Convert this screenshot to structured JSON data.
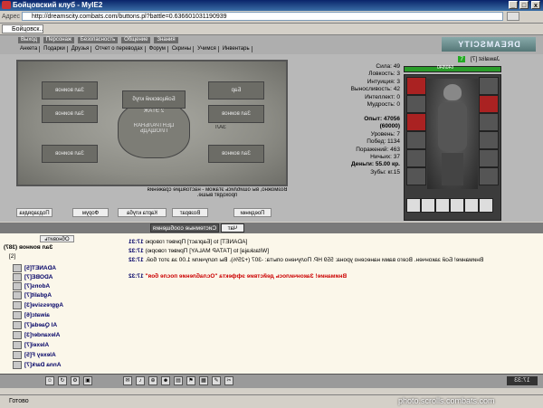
{
  "window": {
    "title": "Бойцовский клуб - MyIE2",
    "buttons": [
      "_",
      "□",
      "x"
    ]
  },
  "address": {
    "label": "Адрес",
    "url": "http://dreamscity.combats.com/buttons.pl?battle=0.636601031190939"
  },
  "tabs": [
    {
      "label": "Бойцовск..."
    }
  ],
  "game_nav": {
    "row1": [
      "Выход",
      "Персонаж",
      "Безопасность",
      "Общение",
      "Знания"
    ],
    "row2": [
      "Анкета",
      "Подарки",
      "Друзья",
      "Отчет о переводах",
      "Форум",
      "Скрины",
      "Учимся",
      "Инвентарь"
    ],
    "logo": "DREAMSCITY"
  },
  "map": {
    "rooms": [
      "Зал воинов",
      "Зал воинов",
      "Бойцовский клуб",
      "Зал воинов",
      "Зал воинов",
      "Бар",
      "Зал воинов"
    ],
    "center": [
      "2 ЭТАЖ",
      "ЦЕНТРАЛЬНАЯ",
      "ПЛОЩАДЬ",
      "ЗАЛ"
    ],
    "note": "Возможно, вы ошиблись этажом - настоящие сражения проходят выше."
  },
  "stats_top": [
    "Сила: 49",
    "Ловкость: 3",
    "Интуиция: 3",
    "Выносливость: 42",
    "Интеллект: 0",
    "Мудрость: 0"
  ],
  "stats_bottom": [
    "Опыт: 47056 (60000)",
    "Уровень: 7",
    "Побед: 1134",
    "Поражений: 463",
    "Ничьих: 37",
    "Деньги: 55.00 кр.",
    "Зубы: кг.15"
  ],
  "character": {
    "nick": "Jawalist [7]",
    "level_badge": "7",
    "hp": "640/640"
  },
  "actions": [
    "Подзарядка",
    "Форум",
    "Карта клуба",
    "Возврат",
    "Поединки"
  ],
  "chat_tabs": [
    "Чат",
    "Системные сообщения"
  ],
  "chat_lines": [
    {
      "time": "17:31",
      "text": "[ADANET] to [Баргаст] Привет говорю"
    },
    {
      "time": "17:32",
      "text": "[Witaskaja] to [ТАТАР МАLAY] Привет говорю)"
    },
    {
      "time": "17:32",
      "text": "Внимание! Бой закончен. Всего вами нанесено урона: 559 HP. Получено опыта: -307 (+25%). Вы получили 1.00 за этот бой."
    },
    {
      "time": "17:32",
      "text": "Внимание! Закончилось действие эффекта \"Ослабление после боя\""
    }
  ],
  "online": {
    "refresh": "Обновить",
    "title": "Зал воинов (387)",
    "count": "[2]",
    "users": [
      "ADANET[5]",
      "ADOBE[7]",
      "Adons[7]",
      "Agdalit[7]",
      "Aggressive[3]",
      "aiwatc[6]",
      "Al Qaeda[7]",
      "Alexander[3]",
      "Alexei[7]",
      "Alexey F[5]",
      "Anna Dark[7]"
    ]
  },
  "bottom": {
    "clock": "17:33",
    "icons": [
      "smile-icon",
      "refresh-icon",
      "settings-icon",
      "lock-icon",
      "letter-icon",
      "sound-icon",
      "zoom-icon",
      "face-icon",
      "book-icon",
      "flag-icon",
      "bag-icon",
      "chat-icon",
      "tool-icon"
    ]
  },
  "status": {
    "text": "Готово",
    "watermark": "photo.scrolls.combats.com"
  }
}
